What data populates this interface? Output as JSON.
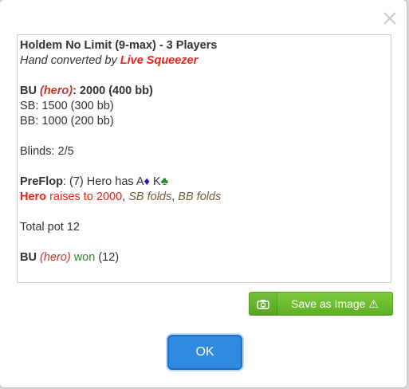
{
  "hand": {
    "title": "Holdem No Limit (9-max) - 3 Players",
    "converted_prefix": "Hand converted by ",
    "converted_brand": "Live Squeezer",
    "bu_label": "BU ",
    "bu_hero": "(hero)",
    "bu_stack": ": 2000 (400 bb)",
    "sb_line": "SB: 1500 (300 bb)",
    "bb_line": "BB: 1000 (200 bb)",
    "blinds_line": "Blinds: 2/5",
    "preflop_label": "PreFlop",
    "preflop_text": ": (7) Hero has A",
    "card1_suit": "♦",
    "card2_rank": " K",
    "card2_suit": "♣",
    "action_hero": "Hero",
    "action_raise": " raises to 2000",
    "action_sep1": ", ",
    "action_sb": "SB folds",
    "action_sep2": ", ",
    "action_bb": "BB folds",
    "total_pot": "Total pot 12",
    "result_bu": "BU ",
    "result_hero": "(hero)",
    "result_won": " won",
    "result_amount": " (12)"
  },
  "buttons": {
    "save_label": "Save as Image ⚠",
    "ok_label": "OK"
  },
  "icons": {
    "close": "close-icon",
    "camera": "camera-icon"
  },
  "colors": {
    "hero_red": "#e8241b",
    "fold_brown": "#7a5a3a",
    "won_green": "#2e8b2e",
    "save_green": "#6cbd30",
    "ok_blue": "#2f8ae0"
  }
}
